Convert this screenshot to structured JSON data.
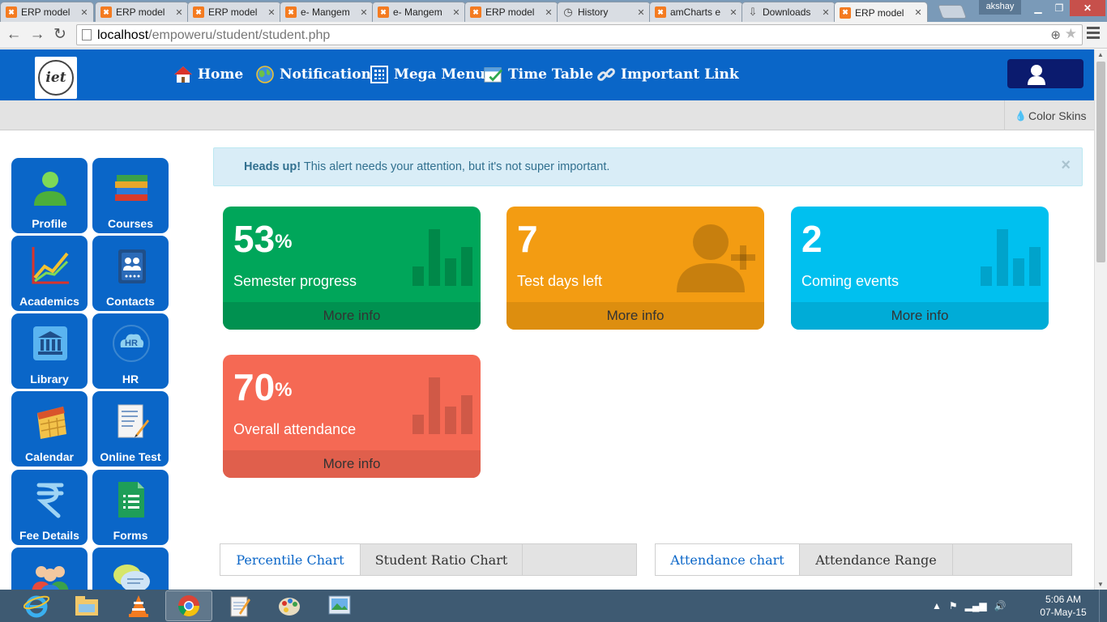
{
  "browser": {
    "tabs": [
      {
        "title": "ERP model",
        "favicon": "xampp-icon",
        "active": false
      },
      {
        "title": "ERP model",
        "favicon": "xampp-icon",
        "active": false
      },
      {
        "title": "ERP model",
        "favicon": "xampp-icon",
        "active": false
      },
      {
        "title": "e- Mangem",
        "favicon": "xampp-icon",
        "active": false
      },
      {
        "title": "e- Mangem",
        "favicon": "xampp-icon",
        "active": false
      },
      {
        "title": "ERP model",
        "favicon": "xampp-icon",
        "active": false
      },
      {
        "title": "History",
        "favicon": "history-icon",
        "active": false
      },
      {
        "title": "amCharts e",
        "favicon": "xampp-icon",
        "active": false
      },
      {
        "title": "Downloads",
        "favicon": "download-icon",
        "active": false
      },
      {
        "title": "ERP model",
        "favicon": "xampp-icon",
        "active": true
      }
    ],
    "user": "akshay",
    "url_host": "localhost",
    "url_path": "/empoweru/student/student.php"
  },
  "nav": {
    "items": [
      {
        "label": "Home",
        "icon": "home-icon"
      },
      {
        "label": "Notification",
        "icon": "globe-icon"
      },
      {
        "label": "Mega Menu",
        "icon": "grid-icon"
      },
      {
        "label": "Time Table",
        "icon": "calendar-check-icon"
      },
      {
        "label": "Important Link",
        "icon": "link-icon"
      }
    ],
    "logo_text": "iet"
  },
  "subbar": {
    "color_skins": "Color Skins"
  },
  "sidebar": {
    "tiles": [
      {
        "label": "Profile",
        "icon": "user-icon"
      },
      {
        "label": "Courses",
        "icon": "books-icon"
      },
      {
        "label": "Academics",
        "icon": "chart-icon"
      },
      {
        "label": "Contacts",
        "icon": "contacts-icon"
      },
      {
        "label": "Library",
        "icon": "library-icon"
      },
      {
        "label": "HR",
        "icon": "hr-icon"
      },
      {
        "label": "Calendar",
        "icon": "calendar-icon"
      },
      {
        "label": "Online Test",
        "icon": "test-icon"
      },
      {
        "label": "Fee Details",
        "icon": "rupee-icon"
      },
      {
        "label": "Forms",
        "icon": "forms-icon"
      },
      {
        "label": "",
        "icon": "group-icon"
      },
      {
        "label": "",
        "icon": "chat-icon"
      }
    ]
  },
  "alert": {
    "strong": "Heads up!",
    "text": " This alert needs your attention, but it's not super important.",
    "close": "×"
  },
  "stats": [
    {
      "value": "53",
      "unit": "%",
      "label": "Semester progress",
      "footer": "More info",
      "color": "#00a65a",
      "icon": "bar-chart-icon"
    },
    {
      "value": "7",
      "unit": "",
      "label": "Test days left",
      "footer": "More info",
      "color": "#f39c12",
      "icon": "user-add-icon"
    },
    {
      "value": "2",
      "unit": "",
      "label": "Coming events",
      "footer": "More info",
      "color": "#00c0ef",
      "icon": "bar-chart-icon"
    },
    {
      "value": "70",
      "unit": "%",
      "label": "Overall attendance",
      "footer": "More info",
      "color": "#f56954",
      "icon": "bar-chart-icon"
    }
  ],
  "chart_tabs": {
    "left": [
      "Percentile Chart",
      "Student Ratio Chart"
    ],
    "right": [
      "Attendance chart",
      "Attendance Range"
    ]
  },
  "taskbar": {
    "apps": [
      "ie-icon",
      "explorer-icon",
      "vlc-icon",
      "chrome-icon",
      "notepad-icon",
      "paint-icon",
      "image-viewer-icon"
    ],
    "time": "5:06 AM",
    "date": "07-May-15"
  }
}
